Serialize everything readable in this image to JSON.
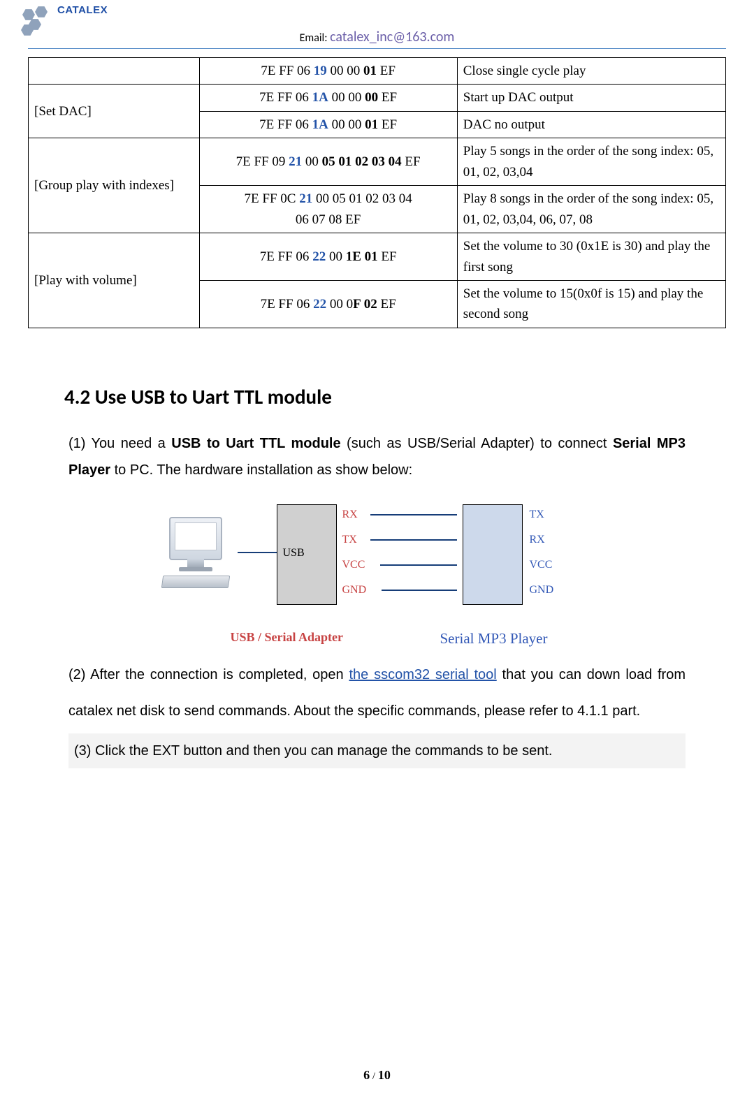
{
  "header": {
    "brand": "CATALEX",
    "email_label": "Email: ",
    "email": "catalex_inc@163.com"
  },
  "table": {
    "rows": [
      {
        "label": "",
        "cmds": [
          {
            "parts": [
              "7E FF 06 ",
              {
                "b": true,
                "blue": true,
                "t": "19"
              },
              " 00 00 ",
              {
                "b": true,
                "t": "01"
              },
              " EF"
            ],
            "desc": "Close single cycle play"
          }
        ]
      },
      {
        "label": "[Set DAC]",
        "cmds": [
          {
            "parts": [
              "7E FF 06 ",
              {
                "b": true,
                "blue": true,
                "t": "1A"
              },
              " 00 00 ",
              {
                "b": true,
                "t": "00"
              },
              " EF"
            ],
            "desc": "Start up DAC output"
          },
          {
            "parts": [
              "7E FF 06 ",
              {
                "b": true,
                "blue": true,
                "t": "1A"
              },
              " 00 00 ",
              {
                "b": true,
                "t": "01"
              },
              " EF"
            ],
            "desc": "DAC no output"
          }
        ]
      },
      {
        "label": "[Group play with indexes]",
        "cmds": [
          {
            "parts": [
              "7E FF 09 ",
              {
                "b": true,
                "blue": true,
                "t": "21"
              },
              " 00 ",
              {
                "b": true,
                "t": "05 01 02 03 04"
              },
              " EF"
            ],
            "desc": "Play 5 songs in the order of the song index: 05, 01, 02, 03,04"
          },
          {
            "parts": [
              "7E FF 0C ",
              {
                "b": true,
                "blue": true,
                "t": "21"
              },
              " 00 05 01 02 03 04",
              "<br>",
              "06 07 08 EF"
            ],
            "desc": "Play 8 songs in the order of the song index: 05, 01, 02, 03,04, 06, 07, 08"
          }
        ]
      },
      {
        "label": "[Play with volume]",
        "cmds": [
          {
            "parts": [
              "7E FF 06 ",
              {
                "b": true,
                "blue": true,
                "t": "22"
              },
              " 00 ",
              {
                "b": true,
                "t": "1E 01"
              },
              " EF"
            ],
            "desc": "Set the volume to 30 (0x1E is 30) and play the first song"
          },
          {
            "parts": [
              "7E FF 06 ",
              {
                "b": true,
                "blue": true,
                "t": "22"
              },
              " 00 0",
              {
                "b": true,
                "t": "F 02"
              },
              " EF"
            ],
            "desc": "Set the volume to 15(0x0f is 15) and play the second song"
          }
        ]
      }
    ]
  },
  "section": {
    "heading": "4.2 Use USB to Uart TTL module",
    "p1_a": "(1) You need a ",
    "p1_b": "USB to Uart TTL module",
    "p1_c": " (such as USB/Serial Adapter) to connect ",
    "p1_d": "Serial MP3 Player",
    "p1_e": " to PC. The hardware installation as show below:",
    "p2_a": "(2) After the connection is completed, open ",
    "p2_link": "the sscom32 serial tool",
    "p2_b": " that you can down load from catalex net disk to send commands. About the specific commands, please refer to 4.1.1 part.",
    "p3": "(3) Click the EXT button and then you can manage the commands to be sent."
  },
  "diagram": {
    "usb_side": "USB",
    "pins_usb": {
      "rx": "RX",
      "tx": "TX",
      "vcc": "VCC",
      "gnd": "GND"
    },
    "pins_mp3": {
      "tx": "TX",
      "rx": "RX",
      "vcc": "VCC",
      "gnd": "GND"
    },
    "caption_usb": "USB / Serial Adapter",
    "caption_mp3": "Serial MP3 Player"
  },
  "footer": {
    "page_cur": "6",
    "page_sep": " / ",
    "page_total": "10"
  }
}
